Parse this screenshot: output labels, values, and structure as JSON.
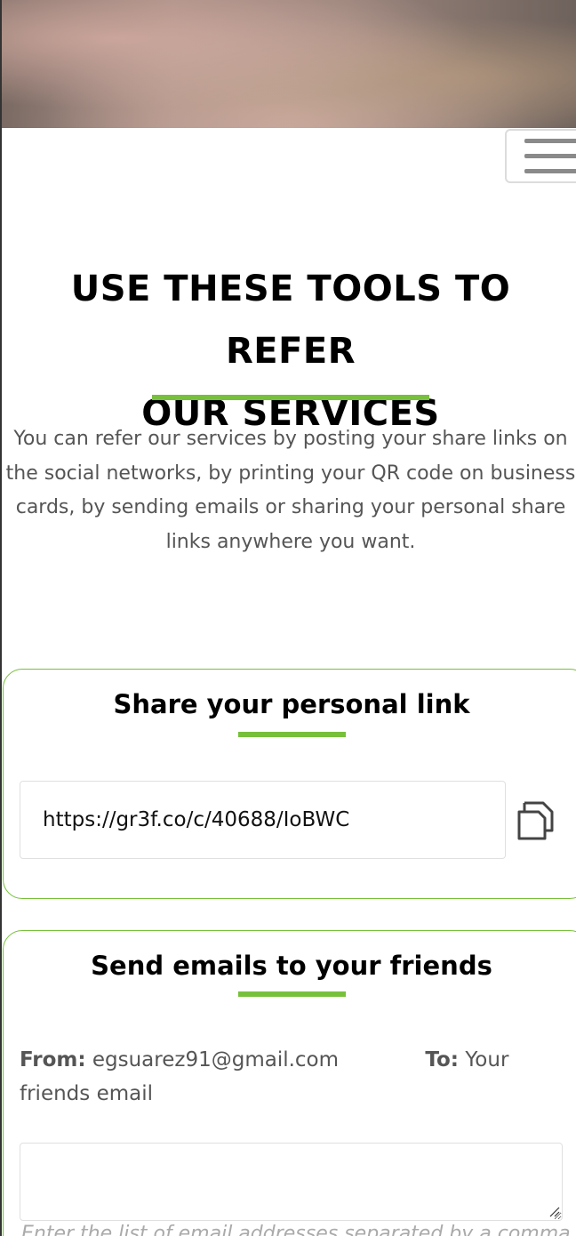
{
  "header": {
    "menu_icon": "hamburger-menu-icon"
  },
  "intro": {
    "title_line1": "USE THESE TOOLS TO REFER",
    "title_line2": "OUR SERVICES",
    "description": "You can refer our services by posting your share links on the social networks, by printing your QR code on business cards, by sending emails or sharing your personal share links anywhere you want."
  },
  "share_link": {
    "title": "Share your personal link",
    "url": "https://gr3f.co/c/40688/IoBWC",
    "copy_icon": "copy-icon"
  },
  "send_emails": {
    "title": "Send emails to your friends",
    "from_label": "From:",
    "from_value": "egsuarez91@gmail.com",
    "to_label": "To:",
    "to_value": "Your friends email",
    "emails_value": "",
    "hint": "Enter the list of email addresses separated by a comma"
  },
  "colors": {
    "accent": "#77c03b",
    "heading": "#000000",
    "body_text": "#555555"
  }
}
